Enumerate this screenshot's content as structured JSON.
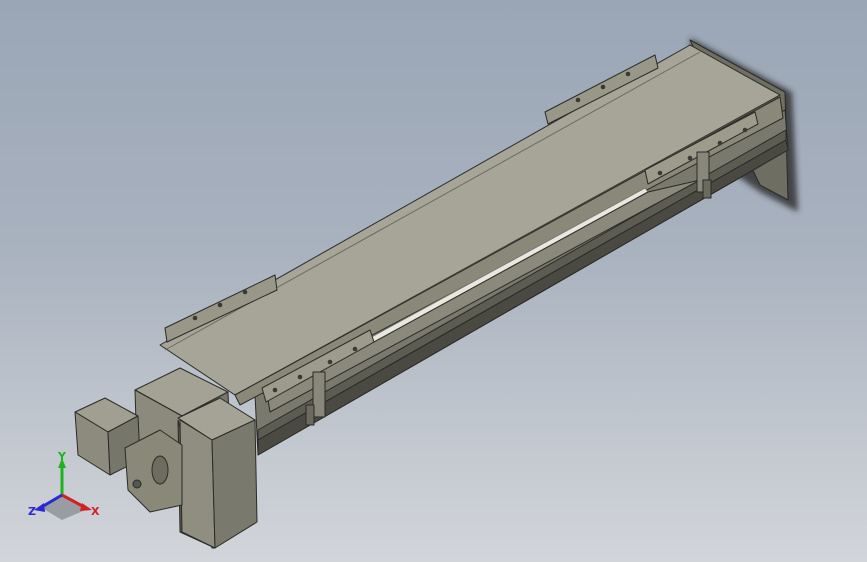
{
  "viewport": {
    "background_top": "#9aa6b6",
    "background_bottom": "#d2d5da"
  },
  "model": {
    "body_color": "#8e8d7d",
    "top_color": "#a4a395",
    "side_color": "#76756a",
    "edge_color": "#2b2b26"
  },
  "triad": {
    "x_label": "X",
    "y_label": "Y",
    "z_label": "Z",
    "x_color": "#d42020",
    "y_color": "#1fb21f",
    "z_color": "#2a2ad0"
  }
}
